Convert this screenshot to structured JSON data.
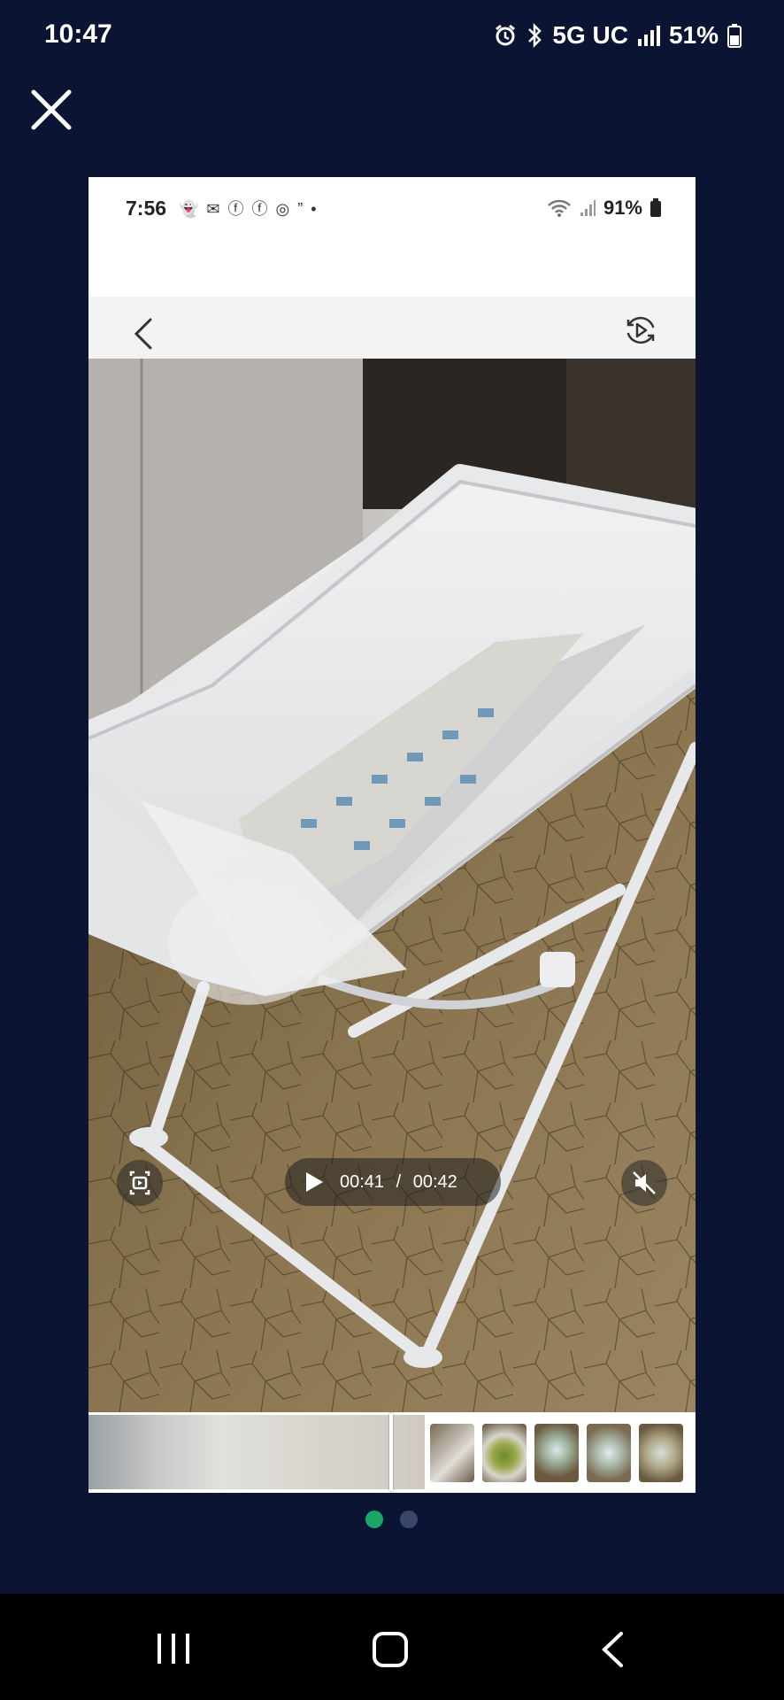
{
  "outer_status": {
    "time": "10:47",
    "network": "5G UC",
    "battery": "51%"
  },
  "inner_status": {
    "time": "7:56",
    "notifications": "👻 ✉ ⓕ ⓕ ◎ ” •",
    "battery": "91%"
  },
  "video": {
    "current_time": "00:41",
    "separator": "/",
    "total_time": "00:42",
    "progress": 0.976
  },
  "colors": {
    "background": "#0b1533",
    "dot_active": "#1aa567",
    "dot_inactive": "#3a4668"
  },
  "pagination": {
    "active_index": 0,
    "count": 2
  }
}
